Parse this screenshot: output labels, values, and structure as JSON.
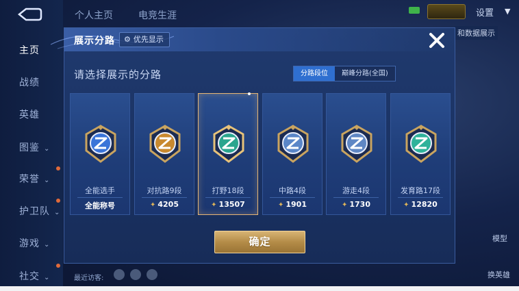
{
  "top_tabs": [
    "个人主页",
    "电竞生涯"
  ],
  "settings_label": "设置",
  "sidebar": {
    "items": [
      {
        "label": "主页",
        "active": true,
        "arrow": false
      },
      {
        "label": "战绩",
        "active": false,
        "arrow": false
      },
      {
        "label": "英雄",
        "active": false,
        "arrow": false
      },
      {
        "label": "图鉴",
        "active": false,
        "arrow": true
      },
      {
        "label": "荣誉",
        "active": false,
        "arrow": true
      },
      {
        "label": "护卫队",
        "active": false,
        "arrow": true
      },
      {
        "label": "游戏",
        "active": false,
        "arrow": true
      },
      {
        "label": "社交",
        "active": false,
        "arrow": true
      }
    ]
  },
  "background": {
    "partial_label": "和数据展示",
    "right_buttons": [
      "模型",
      "换英雄"
    ],
    "recent_visitors_label": "最近访客:"
  },
  "dialog": {
    "title": "展示分路",
    "priority_button": "优先显示",
    "subtitle": "请选择展示的分路",
    "toggle": {
      "options": [
        "分路段位",
        "巅峰分路(全国)"
      ],
      "selected": 0
    },
    "cards": [
      {
        "label": "全能选手",
        "bottom": "全能称号",
        "score": null,
        "selected": false,
        "emblem": "all-round-emblem-icon"
      },
      {
        "label": "对抗路9段",
        "bottom": "4205",
        "score": 4205,
        "selected": false,
        "emblem": "clash-lane-emblem-icon"
      },
      {
        "label": "打野18段",
        "bottom": "13507",
        "score": 13507,
        "selected": true,
        "emblem": "jungle-emblem-icon"
      },
      {
        "label": "中路4段",
        "bottom": "1901",
        "score": 1901,
        "selected": false,
        "emblem": "mid-lane-emblem-icon"
      },
      {
        "label": "游走4段",
        "bottom": "1730",
        "score": 1730,
        "selected": false,
        "emblem": "roam-emblem-icon"
      },
      {
        "label": "发育路17段",
        "bottom": "12820",
        "score": 12820,
        "selected": false,
        "emblem": "farm-lane-emblem-icon"
      }
    ],
    "confirm_label": "确定"
  },
  "colors": {
    "accent_gold": "#e7b675",
    "toggle_selected": "#2f6fd0",
    "dialog_bg": "#1a3263"
  }
}
